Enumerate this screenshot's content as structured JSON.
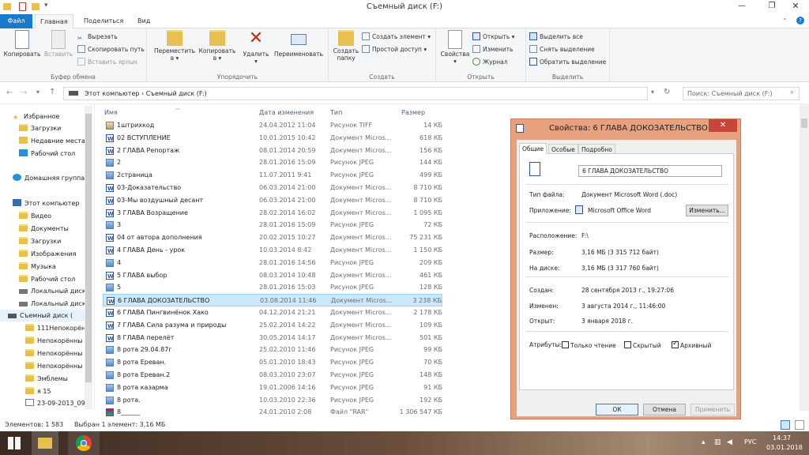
{
  "window": {
    "title": "Съемный диск (F:)"
  },
  "tabs": [
    {
      "label": "Файл"
    },
    {
      "label": "Главная"
    },
    {
      "label": "Поделиться"
    },
    {
      "label": "Вид"
    }
  ],
  "ribbon": {
    "clipboard": {
      "copy": "Копировать",
      "paste": "Вставить",
      "cut": "Вырезать",
      "copy_path": "Скопировать путь",
      "paste_shortcut": "Вставить ярлык",
      "label": "Буфер обмена"
    },
    "organize": {
      "move": "Переместить",
      "move2": "в ▾",
      "copy": "Копировать",
      "copy2": "в ▾",
      "delete": "Удалить",
      "delete2": "▾",
      "rename": "Переименовать",
      "label": "Упорядочить"
    },
    "create": {
      "new_folder": "Создать",
      "new_folder2": "папку",
      "new_item": "Создать элемент ▾",
      "easy_access": "Простой доступ ▾",
      "label": "Создать"
    },
    "open": {
      "properties": "Свойства",
      "properties2": "▾",
      "open": "Открыть ▾",
      "edit": "Изменить",
      "history": "Журнал",
      "label": "Открыть"
    },
    "select": {
      "select_all": "Выделить все",
      "select_none": "Снять выделение",
      "invert": "Обратить выделение",
      "label": "Выделить"
    }
  },
  "address": {
    "path": "Этот компьютер  ›  Съемный диск (F:)",
    "search_placeholder": "Поиск: Съемный диск (F:)"
  },
  "nav": {
    "favorites": "Избранное",
    "downloads": "Загрузки",
    "recent": "Недавние места",
    "desktop": "Рабочий стол",
    "homegroup": "Домашняя группа",
    "this_pc": "Этот компьютер",
    "video": "Видео",
    "documents": "Документы",
    "downloads2": "Загрузки",
    "pictures": "Изображения",
    "music": "Музыка",
    "desktop2": "Рабочий стол",
    "local1": "Локальный диск",
    "local2": "Локальный диск",
    "removable": "Съемный диск (",
    "sub1": "111Непокорён",
    "sub2": "Непокорённы",
    "sub3": "Непокорённы",
    "sub4": "Непокорённы",
    "sub5": "Эмблемы",
    "sub6": "я 15",
    "sub7": "23-09-2013_09-"
  },
  "columns": {
    "name": "Имя",
    "date": "Дата изменения",
    "type": "Тип",
    "size": "Размер"
  },
  "files": [
    {
      "name": "1штрихкод",
      "date": "24.04.2012 11:04",
      "type": "Рисунок TIFF",
      "size": "14 КБ",
      "icon": "tif"
    },
    {
      "name": "02 ВСТУПЛЕНИЕ",
      "date": "10.01.2015 10:42",
      "type": "Документ Micros...",
      "size": "618 КБ",
      "icon": "doc"
    },
    {
      "name": "2 ГЛАВА Репортаж",
      "date": "08.01.2014 20:59",
      "type": "Документ Micros...",
      "size": "156 КБ",
      "icon": "doc"
    },
    {
      "name": "2",
      "date": "28.01.2016 15:09",
      "type": "Рисунок JPEG",
      "size": "144 КБ",
      "icon": "img"
    },
    {
      "name": "2страница",
      "date": "11.07.2011 9:41",
      "type": "Рисунок JPEG",
      "size": "499 КБ",
      "icon": "img"
    },
    {
      "name": "03-Доказательство",
      "date": "06.03.2014 21:00",
      "type": "Документ Micros...",
      "size": "8 710 КБ",
      "icon": "doc"
    },
    {
      "name": "03-Мы воздушный десант",
      "date": "06.03.2014 21:00",
      "type": "Документ Micros...",
      "size": "8 710 КБ",
      "icon": "doc"
    },
    {
      "name": "3 ГЛАВА Возращение",
      "date": "28.02.2014 16:02",
      "type": "Документ Micros...",
      "size": "1 095 КБ",
      "icon": "doc"
    },
    {
      "name": "3",
      "date": "28.01.2016 15:09",
      "type": "Рисунок JPEG",
      "size": "72 КБ",
      "icon": "img"
    },
    {
      "name": "04 от автора дополнения",
      "date": "20.02.2015 10:27",
      "type": "Документ Micros...",
      "size": "75 231 КБ",
      "icon": "doc"
    },
    {
      "name": "4 ГЛАВА День - урок",
      "date": "10.03.2014 8:42",
      "type": "Документ Micros...",
      "size": "1 150 КБ",
      "icon": "doc"
    },
    {
      "name": "4",
      "date": "28.01.2016 14:56",
      "type": "Рисунок JPEG",
      "size": "209 КБ",
      "icon": "img"
    },
    {
      "name": "5 ГЛАВА  выбор",
      "date": "08.03.2014 10:48",
      "type": "Документ Micros...",
      "size": "461 КБ",
      "icon": "doc"
    },
    {
      "name": "5",
      "date": "28.01.2016 15:03",
      "type": "Рисунок JPEG",
      "size": "128 КБ",
      "icon": "img"
    },
    {
      "name": "6 ГЛАВА ДОКОЗАТЕЛЬСТВО",
      "date": "03.08.2014 11:46",
      "type": "Документ Micros...",
      "size": "3 238 КБ",
      "icon": "doc",
      "selected": true
    },
    {
      "name": "6 ГЛАВА Пингвинёнок Хако",
      "date": "04.12.2014 21:21",
      "type": "Документ Micros...",
      "size": "2 178 КБ",
      "icon": "doc"
    },
    {
      "name": "7 ГЛАВА Сила разума и природы",
      "date": "25.02.2014 14:22",
      "type": "Документ Micros...",
      "size": "109 КБ",
      "icon": "doc"
    },
    {
      "name": "8 ГЛАВА перелёт",
      "date": "30.05.2014 14:17",
      "type": "Документ Micros...",
      "size": "501 КБ",
      "icon": "doc"
    },
    {
      "name": "8 рота 29.04.87г",
      "date": "25.02.2010 11:46",
      "type": "Рисунок JPEG",
      "size": "99 КБ",
      "icon": "img"
    },
    {
      "name": "8 рота Ереван.",
      "date": "05.01.2010 18:43",
      "type": "Рисунок JPEG",
      "size": "70 КБ",
      "icon": "img"
    },
    {
      "name": "8 рота Ереван.2",
      "date": "08.03.2010 23:07",
      "type": "Рисунок JPEG",
      "size": "148 КБ",
      "icon": "img"
    },
    {
      "name": "8 рота казарма",
      "date": "19.01.2006 14:16",
      "type": "Рисунок JPEG",
      "size": "91 КБ",
      "icon": "img"
    },
    {
      "name": "8 рота.",
      "date": "10.03.2010 22:36",
      "type": "Рисунок JPEG",
      "size": "192 КБ",
      "icon": "img"
    },
    {
      "name": "8______",
      "date": "24.01.2010 2:08",
      "type": "Файл \"RAR\"",
      "size": "1 306 547 КБ",
      "icon": "rar"
    }
  ],
  "status": {
    "count": "Элементов: 1 583",
    "selected": "Выбран 1 элемент: 3,16 МБ"
  },
  "taskbar": {
    "lang": "РУС",
    "time": "14:37",
    "date": "03.01.2018"
  },
  "dialog": {
    "title": "Свойства: 6 ГЛАВА ДОКОЗАТЕЛЬСТВО",
    "tabs": [
      "Общие",
      "Особые",
      "Подробно"
    ],
    "filename": "6 ГЛАВА ДОКОЗАТЕЛЬСТВО",
    "type_label": "Тип файла:",
    "type_value": "Документ Microsoft Word (.doc)",
    "app_label": "Приложение:",
    "app_value": "Microsoft Office Word",
    "change": "Изменить...",
    "location_label": "Расположение:",
    "location_value": "F:\\",
    "size_label": "Размер:",
    "size_value": "3,16 МБ (3 315 712 байт)",
    "disk_label": "На диске:",
    "disk_value": "3,16 МБ (3 317 760 байт)",
    "created_label": "Создан:",
    "created_value": "28 сентября 2013 г., 19:27:06",
    "modified_label": "Изменен:",
    "modified_value": "3 августа 2014 г., 11:46:00",
    "opened_label": "Открыт:",
    "opened_value": "3 января 2018 г.",
    "attr_label": "Атрибуты:",
    "readonly": "Только чтение",
    "hidden": "Скрытый",
    "archive": "Архивный",
    "ok": "ОК",
    "cancel": "Отмена",
    "apply": "Применить"
  }
}
